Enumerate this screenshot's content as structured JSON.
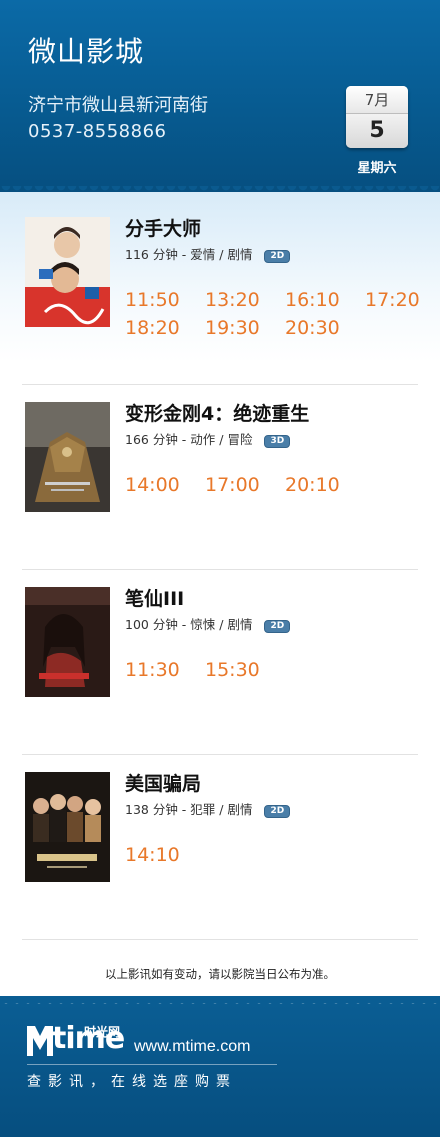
{
  "header": {
    "cinema_name": "微山影城",
    "address": "济宁市微山县新河南街",
    "phone": "0537-8558866",
    "date": {
      "month": "7月",
      "day": "5",
      "weekday": "星期六"
    }
  },
  "movies": [
    {
      "title": "分手大师",
      "meta": "116  分钟 - 爱情 / 剧情",
      "format": "2D",
      "showtimes": [
        "11:50",
        "13:20",
        "16:10",
        "17:20",
        "18:20",
        "19:30",
        "20:30"
      ]
    },
    {
      "title": "变形金刚4：绝迹重生",
      "meta": "166 分钟 - 动作 / 冒险",
      "format": "3D",
      "showtimes": [
        "14:00",
        "17:00",
        "20:10"
      ]
    },
    {
      "title": "笔仙III",
      "meta": "100 分钟 - 惊悚 / 剧情",
      "format": "2D",
      "showtimes": [
        "11:30",
        "15:30"
      ]
    },
    {
      "title": "美国骗局",
      "meta": "138  分钟 - 犯罪 / 剧情",
      "format": "2D",
      "showtimes": [
        "14:10"
      ]
    }
  ],
  "notice": "以上影讯如有变动，请以影院当日公布为准。",
  "footer": {
    "logo_text": "time",
    "logo_cn": "时光网",
    "url": "www.mtime.com",
    "slogan": "查影讯，在线选座购票"
  },
  "colors": {
    "header_blue": "#0b6aa7",
    "showtime_orange": "#e8782a",
    "badge_blue": "#4a7ea8"
  }
}
